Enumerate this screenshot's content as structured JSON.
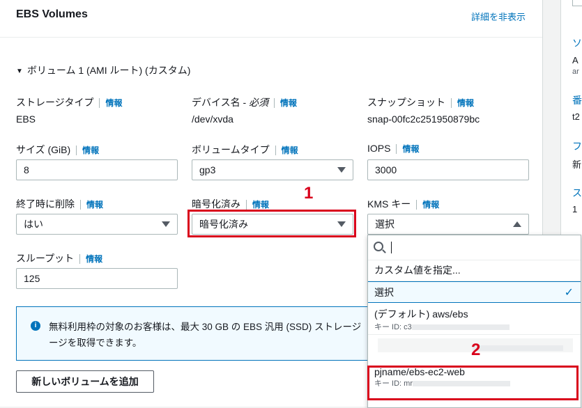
{
  "header": {
    "title": "EBS Volumes",
    "toggle_link": "詳細を非表示"
  },
  "volume": {
    "heading": "ボリューム 1 (AMI ルート) (カスタム)"
  },
  "info_label": "情報",
  "fields": {
    "storage_type": {
      "label": "ストレージタイプ",
      "value": "EBS"
    },
    "device_name": {
      "label": "デバイス名 - ",
      "label_em": "必須",
      "value": "/dev/xvda"
    },
    "snapshot": {
      "label": "スナップショット",
      "value": "snap-00fc2c251950879bc"
    },
    "size": {
      "label": "サイズ (GiB)",
      "value": "8"
    },
    "volume_type": {
      "label": "ボリュームタイプ",
      "value": "gp3"
    },
    "iops": {
      "label": "IOPS",
      "value": "3000"
    },
    "delete_on_termination": {
      "label": "終了時に削除",
      "value": "はい"
    },
    "encrypted": {
      "label": "暗号化済み",
      "value": "暗号化済み"
    },
    "kms_key": {
      "label": "KMS キー",
      "value": "選択"
    },
    "throughput": {
      "label": "スループット",
      "value": "125"
    }
  },
  "alert": {
    "text": "無料利用枠の対象のお客様は、最大 30 GB の EBS 汎用 (SSD) ストレージを取得できます。",
    "text_line1": "無料利用枠の対象のお客様は、最大 30 GB の EBS 汎用 (SSD) ストレージ",
    "text_line2": "ージを取得できます。"
  },
  "add_volume_button": "新しいボリュームを追加",
  "kms_dropdown": {
    "search_placeholder": "",
    "items": [
      {
        "label": "カスタム値を指定..."
      },
      {
        "label": "選択",
        "selected": true
      },
      {
        "label": "(デフォルト) aws/ebs",
        "sub": "キー ID: c3"
      },
      {
        "label": "pjname/ebs-ec2-web",
        "sub": "キー ID: mr"
      }
    ]
  },
  "annotations": {
    "step1": "1",
    "step2": "2",
    "color": "#d9001b"
  },
  "right_panel": {
    "chars": [
      "ソ",
      "A",
      "ar",
      "番",
      "t2",
      "フ",
      "新",
      "ス",
      "1"
    ]
  },
  "colors": {
    "link": "#0073bb",
    "border": "#aab7b8",
    "alert_bg": "#f1faff"
  }
}
